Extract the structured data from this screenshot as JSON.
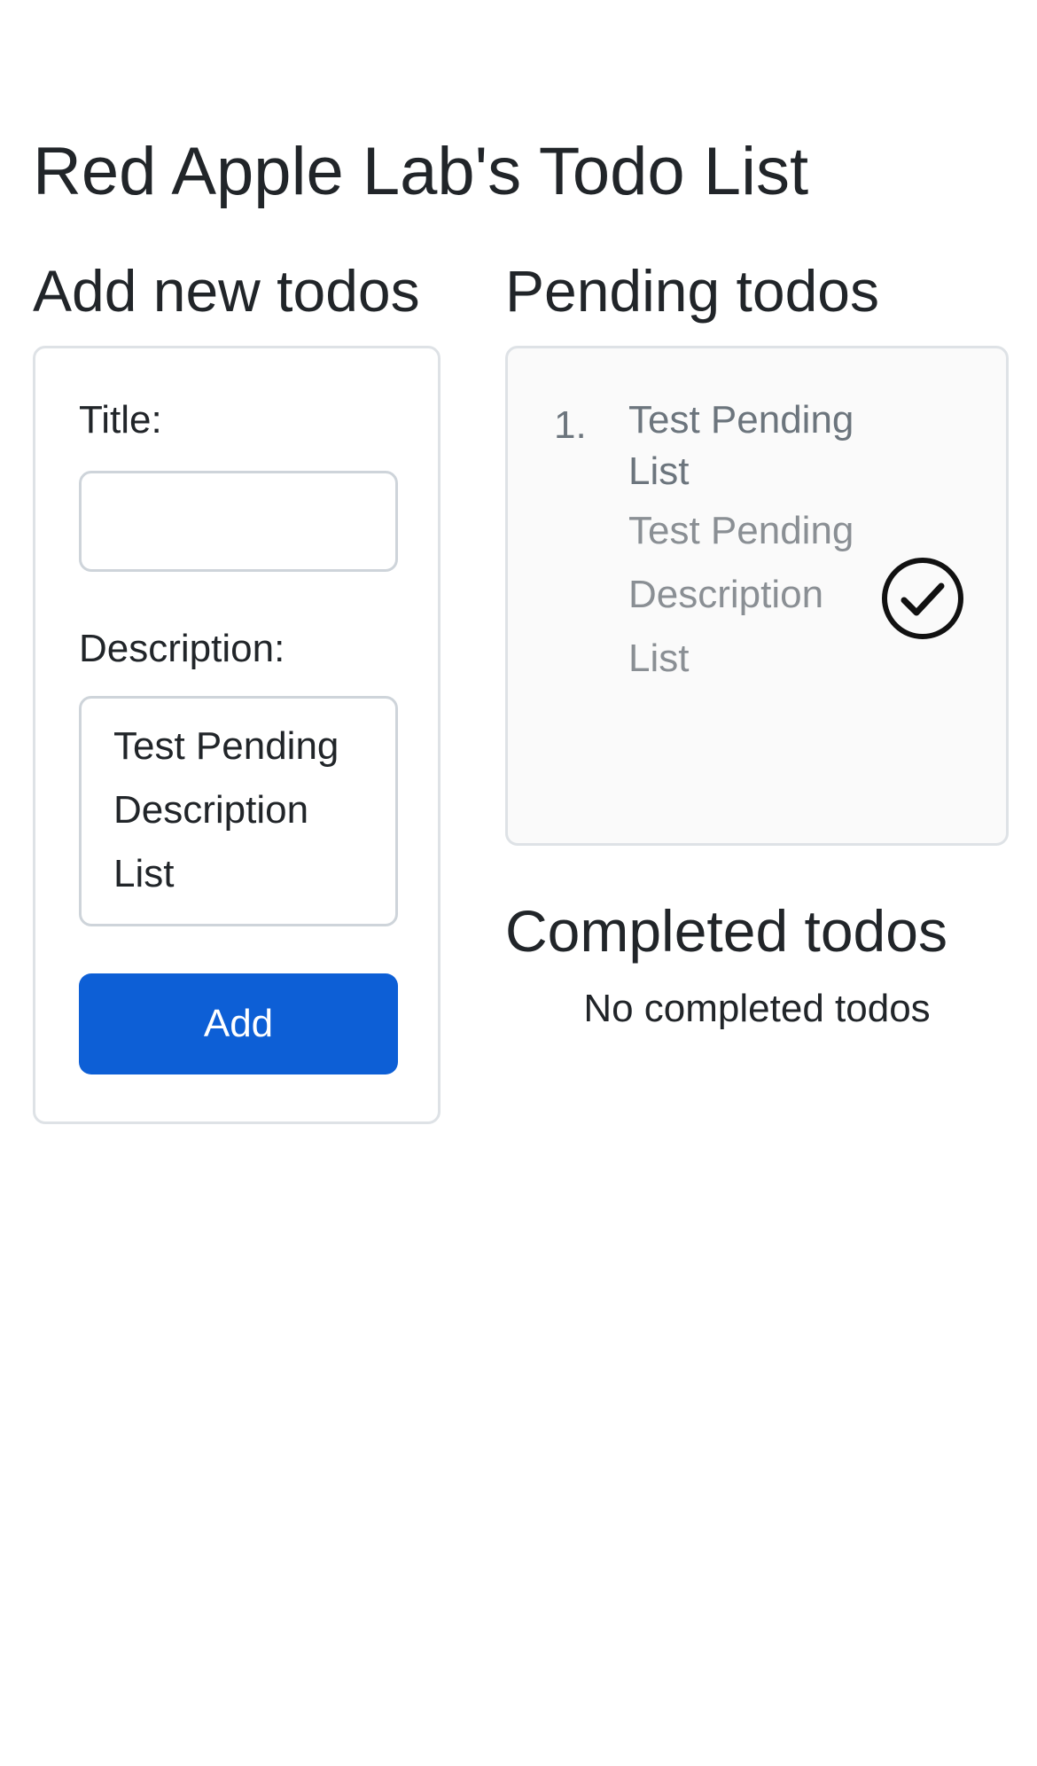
{
  "header": {
    "title": "Red Apple Lab's Todo List"
  },
  "add_section": {
    "heading": "Add new todos",
    "title_label": "Title:",
    "title_value": "",
    "description_label": "Description:",
    "description_value": "Test Pending Description List",
    "add_button_label": "Add",
    "button_color": "#0d5fd6"
  },
  "pending_section": {
    "heading": "Pending todos",
    "items": [
      {
        "number": "1.",
        "title": "Test Pending List",
        "description": "Test Pending Description List",
        "action_icon": "check-circle-icon"
      }
    ]
  },
  "completed_section": {
    "heading": "Completed todos",
    "empty_message": "No completed todos"
  }
}
